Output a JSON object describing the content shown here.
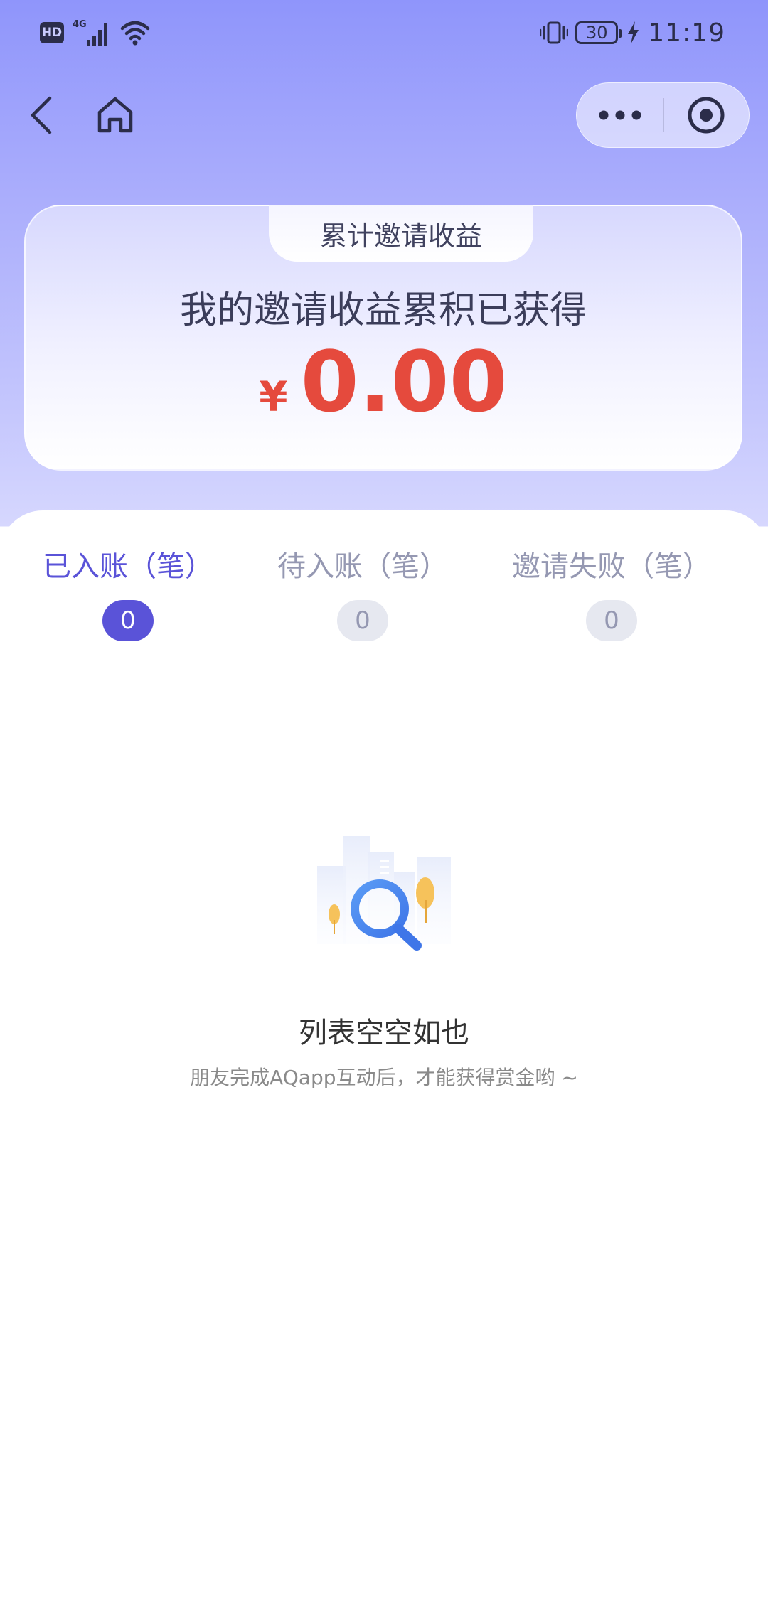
{
  "status_bar": {
    "hd_label": "HD",
    "network_label": "4G",
    "battery_level": "30",
    "time": "11:19",
    "icons": [
      "signal-icon",
      "wifi-icon",
      "vibrate-icon",
      "battery-icon",
      "charging-icon"
    ]
  },
  "nav": {
    "back_icon": "chevron-left-icon",
    "home_icon": "home-icon",
    "more_icon": "more-dots-icon",
    "close_icon": "target-close-icon"
  },
  "earnings_card": {
    "tab_label": "累计邀请收益",
    "subtitle": "我的邀请收益累积已获得",
    "currency": "¥",
    "amount": "0.00",
    "amount_color": "#e54a3d"
  },
  "tabs": [
    {
      "label": "已入账（笔）",
      "count": "0",
      "active": true
    },
    {
      "label": "待入账（笔）",
      "count": "0",
      "active": false
    },
    {
      "label": "邀请失败（笔）",
      "count": "0",
      "active": false
    }
  ],
  "empty_state": {
    "icon": "empty-search-icon",
    "title": "列表空空如也",
    "description": "朋友完成AQapp互动后，才能获得赏金哟 ~"
  },
  "colors": {
    "accent": "#5a53d8",
    "inactive_text": "#9598b2",
    "header_gradient_top": "#8f95fb"
  }
}
